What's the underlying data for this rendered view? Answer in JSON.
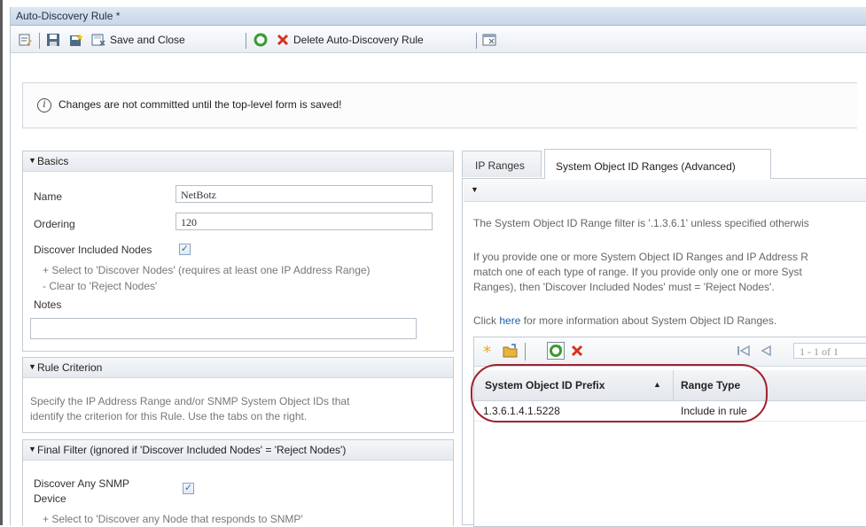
{
  "window": {
    "title": "Auto-Discovery Rule *"
  },
  "toolbar": {
    "save_close_label": "Save and Close",
    "delete_label": "Delete Auto-Discovery Rule"
  },
  "notice": {
    "message": "Changes are not committed until the top-level form is saved!"
  },
  "basics": {
    "header": "Basics",
    "name_label": "Name",
    "name_value": "NetBotz",
    "ordering_label": "Ordering",
    "ordering_value": "120",
    "discover_label": "Discover Included Nodes",
    "discover_checked": true,
    "hint1": "+ Select to 'Discover Nodes' (requires at least one IP Address Range)",
    "hint2": "- Clear to 'Reject Nodes'",
    "notes_label": "Notes",
    "notes_value": ""
  },
  "rule_criterion": {
    "header": "Rule Criterion",
    "text1": "Specify the IP Address Range and/or SNMP System Object IDs that",
    "text2": "identify the criterion for this Rule. Use the tabs on the right."
  },
  "final_filter": {
    "header": "Final Filter (ignored if 'Discover Included Nodes' = 'Reject Nodes')",
    "snmp_label_line1": "Discover Any SNMP",
    "snmp_label_line2": "Device",
    "snmp_checked": true,
    "hint": "+ Select to 'Discover any Node that responds to SNMP'"
  },
  "tabs": [
    {
      "label": "IP Ranges"
    },
    {
      "label": "System Object ID Ranges (Advanced)"
    }
  ],
  "sysobj_panel": {
    "line1": "The System Object ID Range filter is '.1.3.6.1' unless specified otherwis",
    "line2": "If you provide one or more System Object ID Ranges and IP Address R",
    "line3": "match one of each type of range. If you provide only one or more Syst",
    "line4": "Ranges), then 'Discover Included Nodes' must = 'Reject Nodes'.",
    "click_pre": "Click ",
    "click_link": "here",
    "click_post": " for more information about System Object ID Ranges."
  },
  "grid": {
    "pager_text": "1 - 1 of 1",
    "columns": [
      "System Object ID Prefix",
      "Range Type"
    ],
    "sort_indicator": "▲",
    "rows": [
      {
        "prefix": "1.3.6.1.4.1.5228",
        "range_type": "Include in rule"
      }
    ]
  },
  "colors": {
    "accent": "#3a6ea5",
    "highlight_oval": "#9e2330",
    "link": "#1f5fa8"
  }
}
